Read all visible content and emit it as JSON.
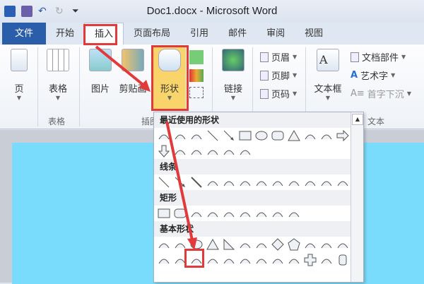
{
  "window": {
    "title": "Doc1.docx - Microsoft Word"
  },
  "tabs": [
    "文件",
    "开始",
    "插入",
    "页面布局",
    "引用",
    "邮件",
    "审阅",
    "视图"
  ],
  "active_tab": "插入",
  "ribbon": {
    "page": "页",
    "table": "表格",
    "table_group": "表格",
    "picture": "图片",
    "clipart": "剪贴画",
    "shapes": "形状",
    "illust_group": "插图",
    "link": "链接",
    "header": "页眉",
    "footer": "页脚",
    "pagenum": "页码",
    "textbox": "文本框",
    "quickparts": "文档部件",
    "wordart": "艺术字",
    "dropcap": "首字下沉",
    "text_group": "文本"
  },
  "gallery": {
    "sections": [
      {
        "title": "最近使用的形状",
        "rows": [
          [
            "explosion",
            "textbox",
            "vertical-textbox",
            "line",
            "arrow-line",
            "rectangle",
            "oval",
            "rounded-rect",
            "triangle",
            "elbow",
            "elbow-arrow",
            "right-arrow"
          ],
          [
            "down-arrow",
            "wave",
            "scribble",
            "arc",
            "curve",
            "brace"
          ]
        ]
      },
      {
        "title": "线条",
        "rows": [
          [
            "line",
            "arrow-line",
            "double-arrow",
            "elbow",
            "elbow-arrow",
            "elbow-double",
            "curve-connector",
            "curve-arrow",
            "curve-double",
            "curve",
            "freeform",
            "scribble"
          ]
        ]
      },
      {
        "title": "矩形",
        "rows": [
          [
            "rectangle",
            "rounded-rect",
            "snip1",
            "snip2",
            "snip-diag",
            "round-snip",
            "round1",
            "round2",
            "round-diag"
          ]
        ]
      },
      {
        "title": "基本形状",
        "rows": [
          [
            "textbox",
            "vertical-textbox",
            "oval",
            "triangle",
            "right-triangle",
            "parallelogram",
            "trapezoid",
            "diamond",
            "pentagon",
            "hexagon",
            "heptagon",
            "octagon"
          ],
          [
            "decagon",
            "dodecagon",
            "pie",
            "chord",
            "teardrop",
            "frame",
            "half-frame",
            "l-shape",
            "diagonal-stripe",
            "cross",
            "plaque",
            "can"
          ]
        ]
      }
    ],
    "selected": "oval"
  },
  "colors": {
    "highlight": "#e23a3a",
    "file_tab": "#2a5eab",
    "page": "#7adcfc",
    "shapes_button": "#f8d46a"
  }
}
